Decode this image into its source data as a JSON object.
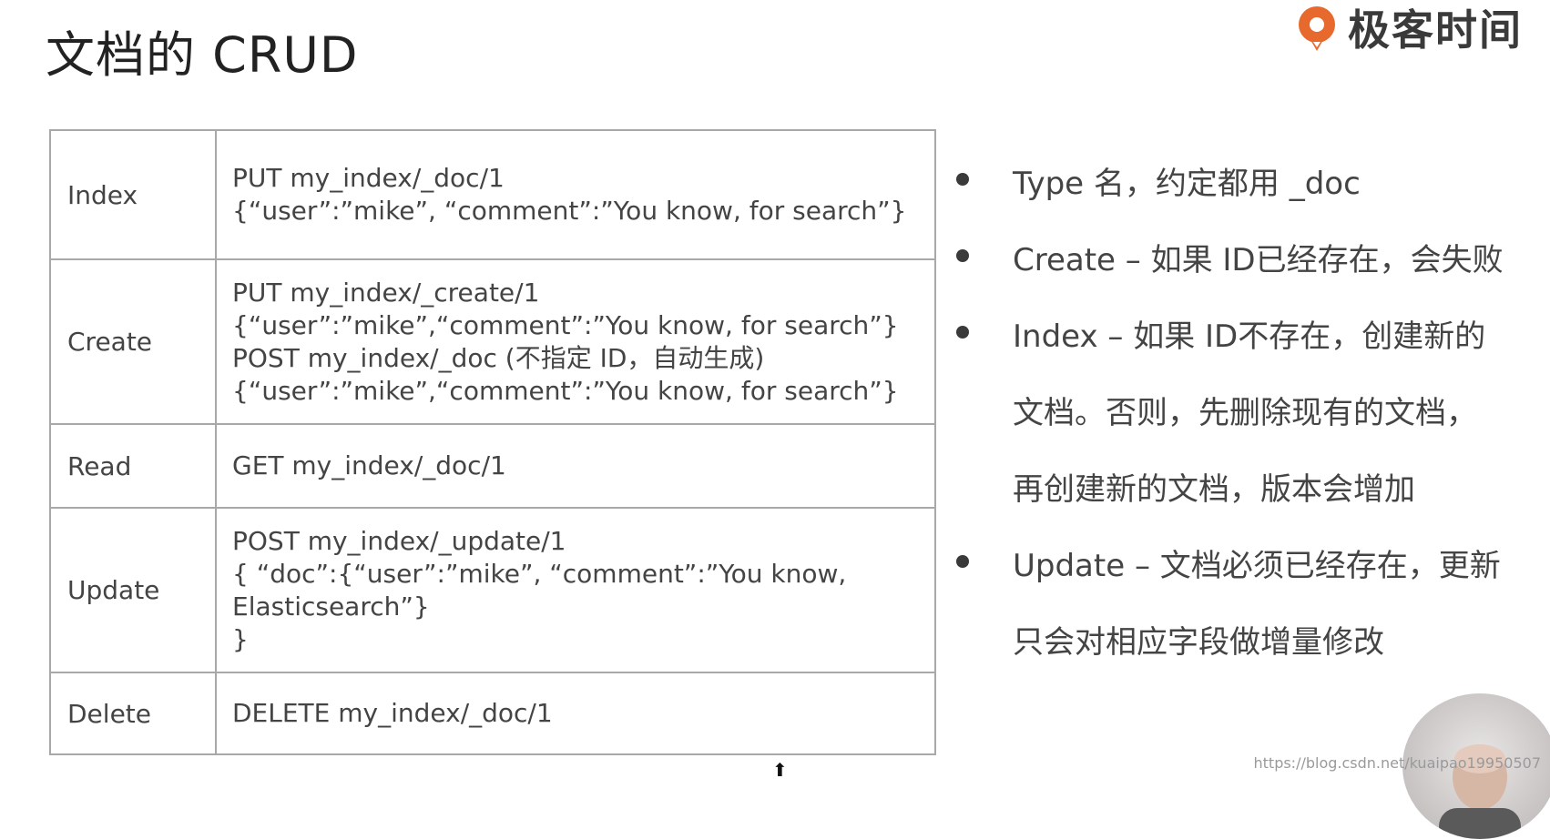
{
  "slide": {
    "title": "文档的 CRUD"
  },
  "logo": {
    "text": "极客时间",
    "accent_color": "#e8692d"
  },
  "crud_table": {
    "rows": [
      {
        "op": "Index",
        "lines": [
          "PUT my_index/_doc/1",
          "{“user”:”mike”, “comment”:”You know, for search”}"
        ]
      },
      {
        "op": "Create",
        "lines": [
          "PUT my_index/_create/1",
          "{“user”:”mike”,“comment”:”You know, for search”}",
          "POST my_index/_doc (不指定 ID，自动生成)",
          "{“user”:”mike”,“comment”:”You know, for search”}"
        ]
      },
      {
        "op": "Read",
        "lines": [
          "GET my_index/_doc/1"
        ]
      },
      {
        "op": "Update",
        "lines": [
          "POST my_index/_update/1",
          "{    “doc”:{“user”:”mike”, “comment”:”You know,",
          "Elasticsearch”}",
          "}"
        ]
      },
      {
        "op": "Delete",
        "lines": [
          "DELETE my_index/_doc/1"
        ]
      }
    ]
  },
  "bullets": [
    {
      "lines": [
        "Type 名，约定都用 _doc"
      ]
    },
    {
      "lines": [
        "Create – 如果 ID已经存在，会失败"
      ]
    },
    {
      "lines": [
        "Index – 如果 ID不存在，创建新的",
        "文档。否则，先删除现有的文档，",
        "再创建新的文档，版本会增加"
      ]
    },
    {
      "lines": [
        "Update – 文档必须已经存在，更新",
        "只会对相应字段做增量修改"
      ]
    }
  ],
  "watermark": "https://blog.csdn.net/kuaipao19950507",
  "icons": {
    "logo": "geektime-logo-icon",
    "cursor": "mouse-cursor-icon",
    "presenter": "presenter-avatar"
  }
}
